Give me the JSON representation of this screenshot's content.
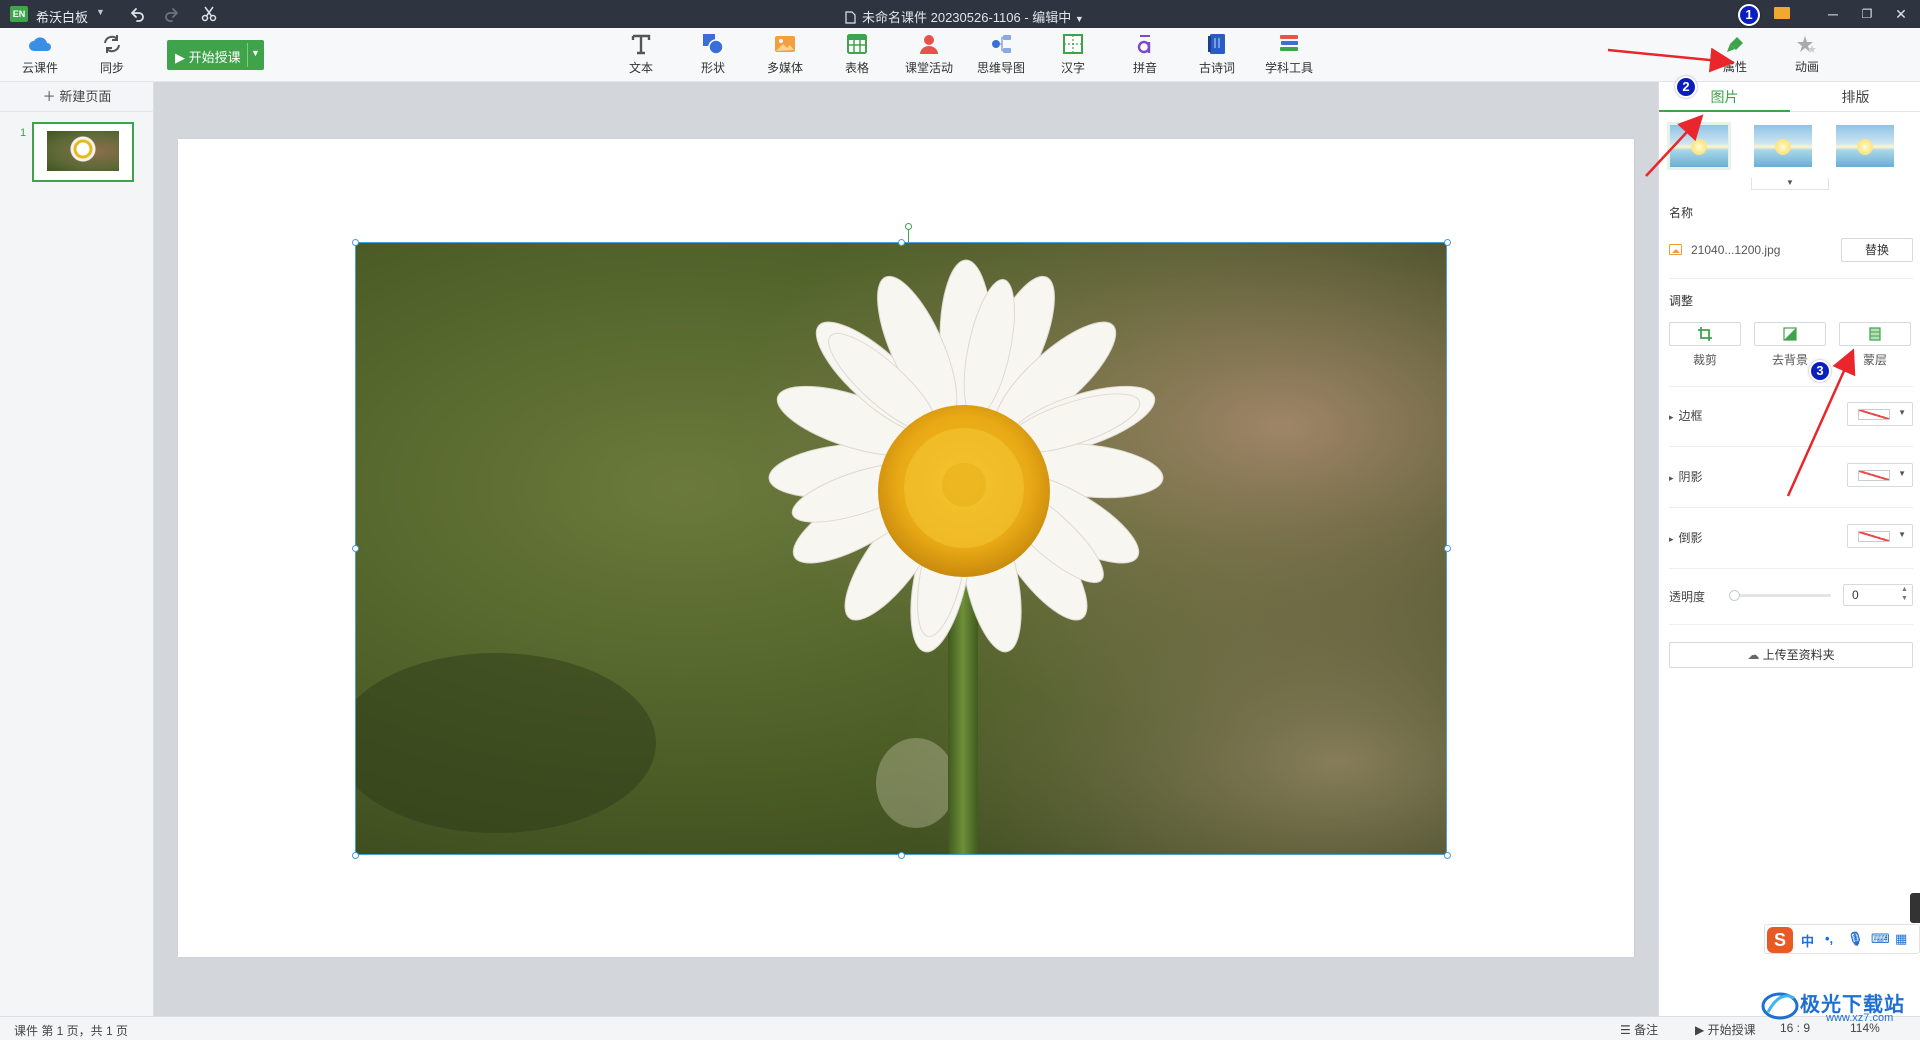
{
  "titlebar": {
    "app_logo": "EN",
    "app_name": "希沃白板",
    "doc_title": "未命名课件 20230526-1106 - 编辑中"
  },
  "toolbar": {
    "cloud_label": "云课件",
    "sync_label": "同步",
    "start_label": "开始授课",
    "tools": [
      {
        "label": "文本",
        "icon": "text-icon"
      },
      {
        "label": "形状",
        "icon": "shape-icon"
      },
      {
        "label": "多媒体",
        "icon": "media-icon"
      },
      {
        "label": "表格",
        "icon": "table-icon"
      },
      {
        "label": "课堂活动",
        "icon": "activity-icon"
      },
      {
        "label": "思维导图",
        "icon": "mindmap-icon"
      },
      {
        "label": "汉字",
        "icon": "hanzi-icon"
      },
      {
        "label": "拼音",
        "icon": "pinyin-icon"
      },
      {
        "label": "古诗词",
        "icon": "poetry-icon"
      },
      {
        "label": "学科工具",
        "icon": "subject-tools-icon"
      }
    ]
  },
  "left_panel": {
    "new_page_label": "新建页面",
    "slide_number": "1"
  },
  "right_panel": {
    "properties_label": "属性",
    "animation_label": "动画",
    "tab_image": "图片",
    "tab_layout": "排版",
    "name_title": "名称",
    "file_name": "21040...1200.jpg",
    "replace_label": "替换",
    "adjust_title": "调整",
    "crop_label": "裁剪",
    "remove_bg_label": "去背景",
    "mask_label": "蒙层",
    "border_label": "边框",
    "shadow_label": "阴影",
    "reflection_label": "倒影",
    "opacity_label": "透明度",
    "opacity_value": "0",
    "upload_label": "上传至资料夹"
  },
  "statusbar": {
    "page_info": "课件 第 1 页，共 1 页",
    "notes_label": "备注",
    "start_label": "开始授课",
    "ratio": "16 : 9",
    "zoom": "114%"
  },
  "annotations": {
    "badge1": "1",
    "badge2": "2",
    "badge3": "3",
    "arrow_color": "#e8262b",
    "badge_color": "#0b1fbf"
  },
  "ime": {
    "logo": "S",
    "item_zh": "中"
  },
  "watermark": {
    "text": "极光下载站",
    "url": "www.xz7.com"
  },
  "colors": {
    "accent": "#3ea34a",
    "selection": "#4a9fd4"
  }
}
